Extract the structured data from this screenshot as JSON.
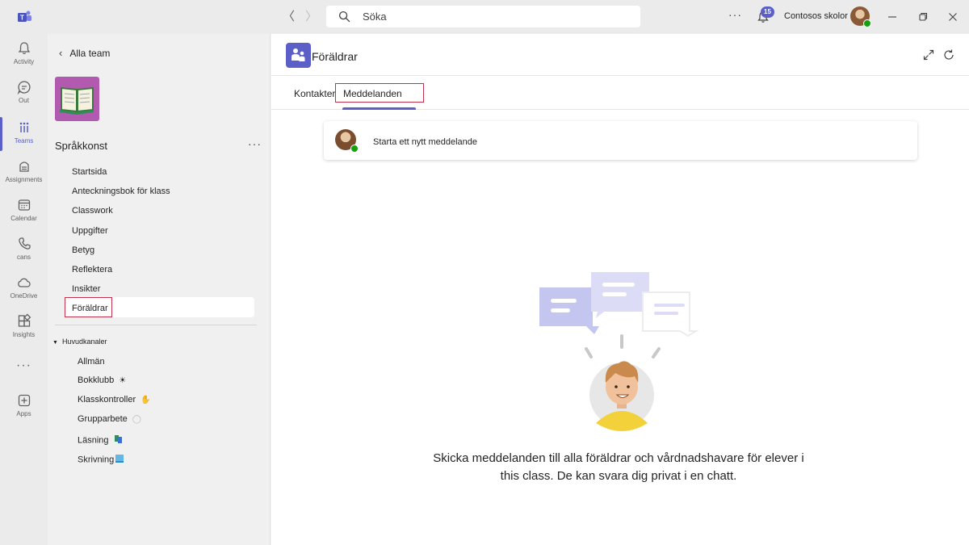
{
  "titlebar": {
    "search_placeholder": "Söka",
    "notification_count": "15",
    "org_name": "Contosos skolor"
  },
  "rail": {
    "items": [
      {
        "label": "Activity",
        "icon": "bell-icon"
      },
      {
        "label": "Out",
        "icon": "chat-icon"
      },
      {
        "label": "Teams",
        "icon": "teams-icon"
      },
      {
        "label": "Assignments",
        "icon": "assignments-icon"
      },
      {
        "label": "Calendar",
        "icon": "calendar-icon"
      },
      {
        "label": "cans",
        "icon": "phone-icon"
      },
      {
        "label": "OneDrive",
        "icon": "cloud-icon"
      },
      {
        "label": "Insights",
        "icon": "insights-icon"
      },
      {
        "label": "Apps",
        "icon": "apps-icon"
      }
    ]
  },
  "panel": {
    "back_label": "Alla team",
    "team_name": "Språkkonst",
    "nav": [
      "Startsida",
      "Anteckningsbok för klass",
      "Classwork",
      "Uppgifter",
      "Betyg",
      "Reflektera",
      "Insikter",
      "Föräldrar"
    ],
    "section_title": "Huvudkanaler",
    "channels": [
      "Allmän",
      "Bokklubb",
      "Klasskontroller",
      "Grupparbete",
      "Läsning",
      "Skrivning"
    ]
  },
  "main": {
    "title": "Föräldrar",
    "tabs": [
      "Kontakter",
      "Meddelanden"
    ],
    "active_tab": "Meddelanden",
    "compose_label": "Starta ett nytt meddelande",
    "empty_line1": "Skicka meddelanden till alla föräldrar och vårdnadshavare för elever i",
    "empty_line2": "this class. De kan svara dig privat i en chatt."
  },
  "colors": {
    "accent": "#5b5fc7",
    "highlight": "#c4314b",
    "team_tile": "#b259b0",
    "presence": "#13a10e"
  }
}
